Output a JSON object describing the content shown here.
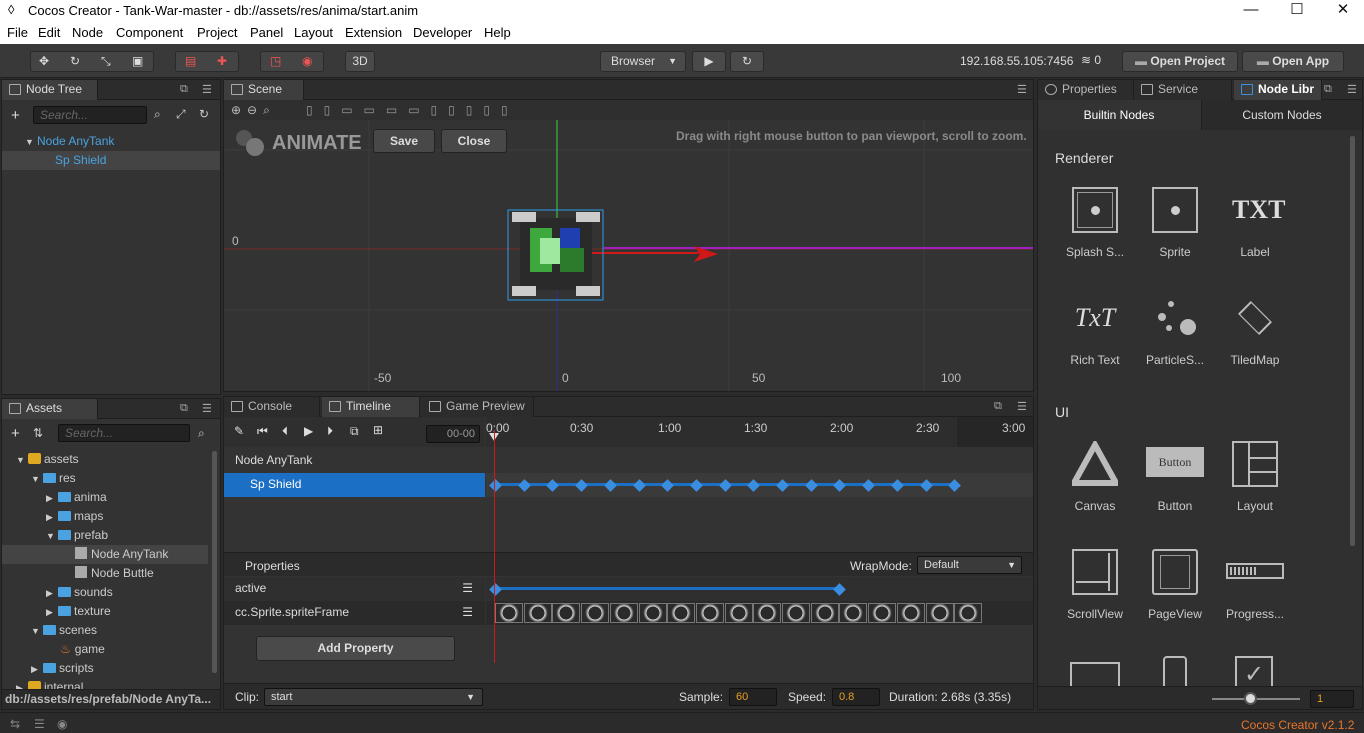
{
  "window": {
    "title": "Cocos Creator - Tank-War-master - db://assets/res/anima/start.anim",
    "minimize": "—",
    "maximize": "☐",
    "close": "✕"
  },
  "menu": [
    "File",
    "Edit",
    "Node",
    "Component",
    "Project",
    "Panel",
    "Layout",
    "Extension",
    "Developer",
    "Help"
  ],
  "toolbar": {
    "mode_3d": "3D",
    "platform": "Browser",
    "play": "▶",
    "refresh": "↻",
    "ip": "192.168.55.105:7456",
    "open_project": "Open Project",
    "open_app": "Open App"
  },
  "node_tree": {
    "tab": "Node Tree",
    "search_placeholder": "Search...",
    "items": [
      {
        "label": "Node AnyTank"
      },
      {
        "label": "Sp Shield"
      }
    ]
  },
  "scene": {
    "tab": "Scene",
    "animate_label": "ANIMATE",
    "save": "Save",
    "close": "Close",
    "hint": "Drag with right mouse button to pan viewport, scroll to zoom.",
    "y_zero": "0",
    "x_ticks": [
      "-50",
      "0",
      "50",
      "100"
    ]
  },
  "assets": {
    "tab": "Assets",
    "search_placeholder": "Search...",
    "items": [
      {
        "label": "assets"
      },
      {
        "label": "res"
      },
      {
        "label": "anima"
      },
      {
        "label": "maps"
      },
      {
        "label": "prefab"
      },
      {
        "label": "Node AnyTank"
      },
      {
        "label": "Node Buttle"
      },
      {
        "label": "sounds"
      },
      {
        "label": "texture"
      },
      {
        "label": "scenes"
      },
      {
        "label": "game"
      },
      {
        "label": "scripts"
      },
      {
        "label": "internal"
      }
    ],
    "path": "db://assets/res/prefab/Node AnyTa..."
  },
  "bottom_tabs": {
    "console": "Console",
    "timeline": "Timeline",
    "game_preview": "Game Preview"
  },
  "timeline": {
    "frame_input": "00-00",
    "ruler": [
      "0:00",
      "0:30",
      "1:00",
      "1:30",
      "2:00",
      "2:30",
      "3:00"
    ],
    "nodes": [
      {
        "label": "Node AnyTank"
      },
      {
        "label": "Sp Shield"
      }
    ],
    "properties_header": "Properties",
    "wrapmode_label": "WrapMode:",
    "wrapmode_value": "Default",
    "props": [
      {
        "label": "active"
      },
      {
        "label": "cc.Sprite.spriteFrame"
      }
    ],
    "add_property": "Add Property",
    "clip_label": "Clip:",
    "clip_value": "start",
    "sample_label": "Sample:",
    "sample_value": "60",
    "speed_label": "Speed:",
    "speed_value": "0.8",
    "duration": "Duration: 2.68s (3.35s)"
  },
  "right_panel": {
    "tabs": [
      "Properties",
      "Service",
      "Node Libr"
    ],
    "sub_tabs": [
      "Builtin Nodes",
      "Custom Nodes"
    ],
    "renderer_header": "Renderer",
    "renderer_items": [
      "Splash S...",
      "Sprite",
      "Label",
      "Rich Text",
      "ParticleS...",
      "TiledMap"
    ],
    "txt_glyph": "TXT",
    "richtext_glyph": "TxT",
    "ui_header": "UI",
    "ui_items": [
      "Canvas",
      "Button",
      "Layout",
      "ScrollView",
      "PageView",
      "Progress..."
    ],
    "button_glyph": "Button",
    "zoom_value": "1"
  },
  "footer": {
    "version": "Cocos Creator v2.1.2"
  }
}
